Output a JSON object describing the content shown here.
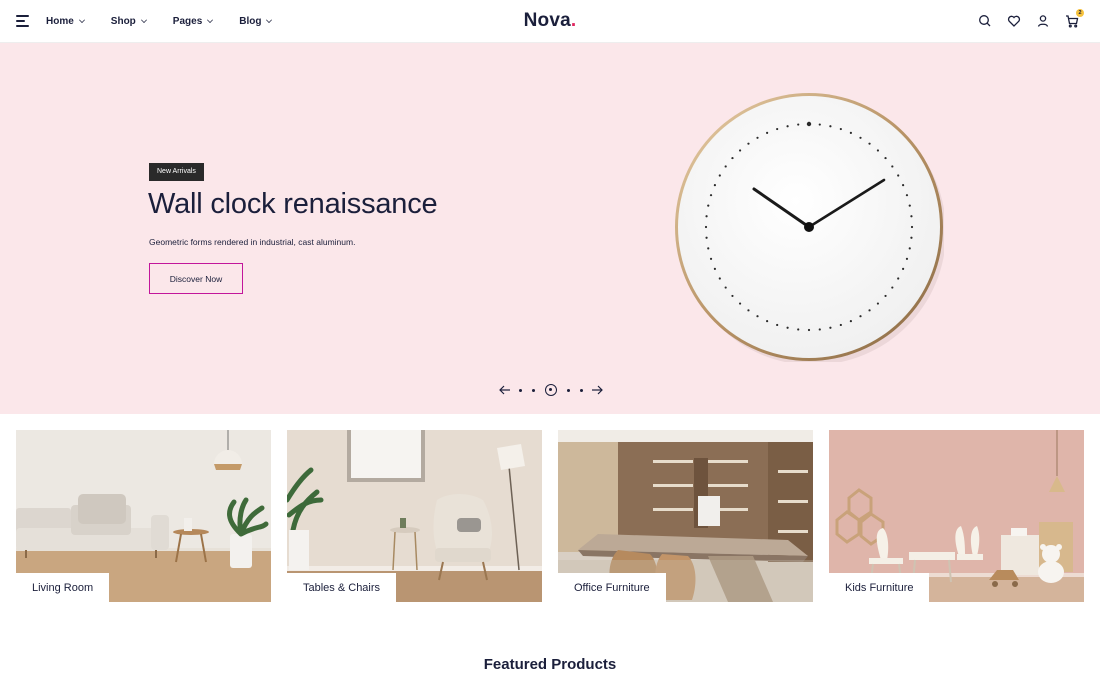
{
  "header": {
    "logo_text": "Nova",
    "logo_dot": ".",
    "nav": [
      {
        "label": "Home"
      },
      {
        "label": "Shop"
      },
      {
        "label": "Pages"
      },
      {
        "label": "Blog"
      }
    ],
    "icons": [
      "search-icon",
      "heart-icon",
      "user-icon",
      "cart-icon"
    ],
    "cart_count": "2"
  },
  "hero": {
    "tag": "New Arrivals",
    "title": "Wall clock renaissance",
    "subtitle": "Geometric forms rendered in industrial, cast aluminum.",
    "cta": "Discover Now",
    "slider": {
      "count": 5,
      "active": 2
    }
  },
  "categories": [
    {
      "label": "Living Room"
    },
    {
      "label": "Tables & Chairs"
    },
    {
      "label": "Office Furniture"
    },
    {
      "label": "Kids Furniture"
    }
  ],
  "featured_title": "Featured Products",
  "colors": {
    "brand_dark": "#1b1f3b",
    "logo_dot": "#e0245e",
    "hero_bg": "#fbe7ea",
    "cta_border": "#c2169b",
    "cart_badge": "#f6c23e"
  }
}
